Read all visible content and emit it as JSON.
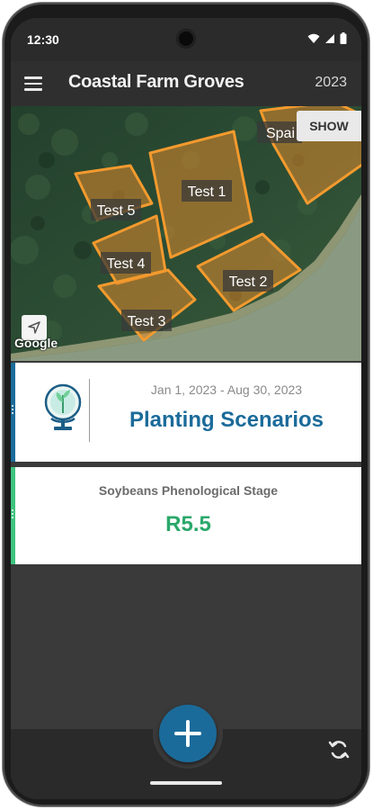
{
  "status_bar": {
    "time": "12:30"
  },
  "app_bar": {
    "title": "Coastal Farm Groves",
    "year": "2023"
  },
  "map": {
    "show_label": "SHOW",
    "attribution": "Google",
    "fields": [
      {
        "label": "Test 1"
      },
      {
        "label": "Test 2"
      },
      {
        "label": "Test 3"
      },
      {
        "label": "Test 4"
      },
      {
        "label": "Test 5"
      },
      {
        "label": "Spai"
      }
    ]
  },
  "scenario_card": {
    "date_range": "Jan 1, 2023 - Aug 30, 2023",
    "title": "Planting Scenarios",
    "accent_color": "#1b6b9a"
  },
  "phenology_card": {
    "label": "Soybeans Phenological Stage",
    "value": "R5.5",
    "accent_color": "#3ec47e"
  },
  "icons": [
    "menu-icon",
    "globe-icon",
    "locate-icon",
    "plus-icon",
    "sync-icon",
    "wifi-icon",
    "signal-icon",
    "battery-icon"
  ]
}
